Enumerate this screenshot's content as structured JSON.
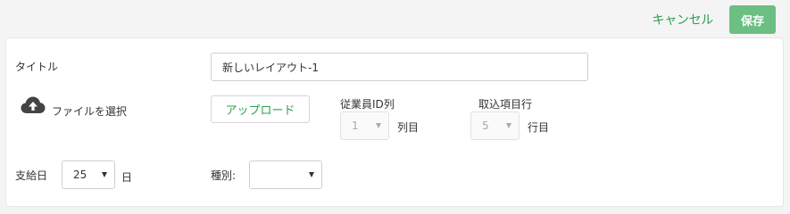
{
  "header": {
    "cancel_label": "キャンセル",
    "save_label": "保存"
  },
  "form": {
    "title_label": "タイトル",
    "title_value": "新しいレイアウト-1",
    "file_select_label": "ファイルを選択",
    "upload_label": "アップロード",
    "employee_id_col_label": "従業員ID列",
    "employee_id_col_value": "1",
    "col_suffix": "列目",
    "import_row_label": "取込項目行",
    "import_row_value": "5",
    "row_suffix": "行目",
    "payday_label": "支給日",
    "payday_value": "25",
    "day_suffix": "日",
    "type_label": "種別:",
    "type_value": ""
  }
}
